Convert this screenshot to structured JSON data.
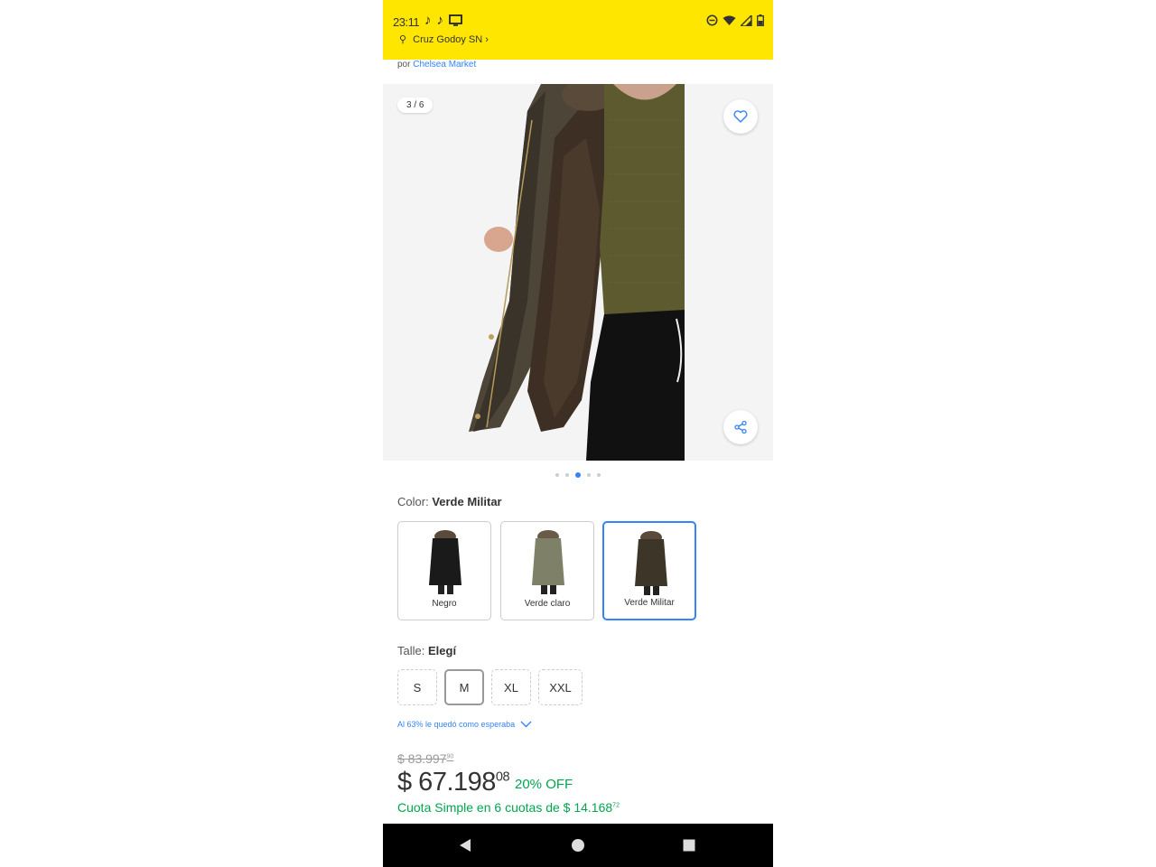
{
  "status_bar": {
    "time": "23:11",
    "app_icons": [
      "tiktok-icon",
      "tiktok-icon",
      "screen-icon"
    ],
    "right_icons": [
      "do-not-disturb-icon",
      "wifi-icon",
      "signal-icon",
      "battery-icon"
    ]
  },
  "header": {
    "address": "Cruz Godoy SN"
  },
  "seller": {
    "prefix": "por",
    "name": "Chelsea Market"
  },
  "gallery": {
    "counter": "3 / 6",
    "image_description_icon": "product-photo",
    "dots_total": 5,
    "active_dot": 3
  },
  "color": {
    "label": "Color:",
    "selected": "Verde Militar",
    "options": [
      {
        "name": "Negro",
        "swatch_color": "#1a1a1a"
      },
      {
        "name": "Verde claro",
        "swatch_color": "#7e8068"
      },
      {
        "name": "Verde Militar",
        "swatch_color": "#3d3527"
      }
    ]
  },
  "size": {
    "label": "Talle:",
    "selected_text": "Elegí",
    "options": [
      "S",
      "M",
      "XL",
      "XXL"
    ]
  },
  "fit": {
    "text": "Al 63% le quedó como esperaba"
  },
  "price": {
    "old_main": "$ 83.997",
    "old_cents": "90",
    "current_main": "$ 67.198",
    "current_cents": "08",
    "discount": "20% OFF",
    "installments_text": "Cuota Simple en 6 cuotas de $ 14.168",
    "installments_cents": "72"
  },
  "colors": {
    "brand_yellow": "#ffe600",
    "link_blue": "#3483fa",
    "success_green": "#00a650"
  }
}
